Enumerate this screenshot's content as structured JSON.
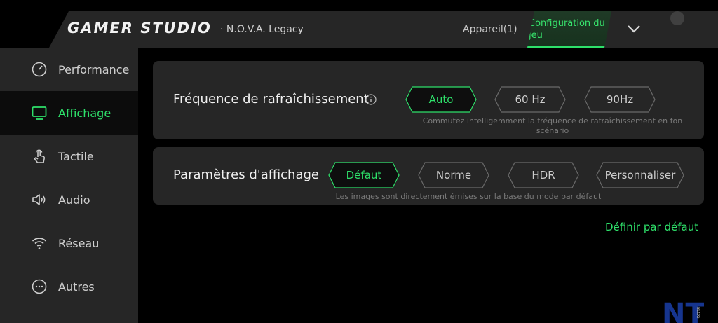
{
  "header": {
    "brand": "GAMER STUDIO",
    "game": "· N.O.V.A. Legacy",
    "device": "Appareil(1)",
    "config_tab": "Configuration du jeu",
    "expand_icon": "chevron-down-icon"
  },
  "sidebar": {
    "items": [
      {
        "label": "Performance",
        "icon": "gauge-icon"
      },
      {
        "label": "Affichage",
        "icon": "monitor-icon"
      },
      {
        "label": "Tactile",
        "icon": "touch-hand-icon"
      },
      {
        "label": "Audio",
        "icon": "speaker-icon"
      },
      {
        "label": "Réseau",
        "icon": "wifi-icon"
      },
      {
        "label": "Autres",
        "icon": "more-dots-icon"
      }
    ],
    "active_index": 1
  },
  "refresh": {
    "title": "Fréquence de rafraîchissement",
    "options": [
      "Auto",
      "60 Hz",
      "90Hz"
    ],
    "selected": "Auto",
    "description": "Commutez intelligemment la fréquence de rafraîchissement en fon scénario"
  },
  "display": {
    "title": "Paramètres d'affichage",
    "options": [
      "Défaut",
      "Norme",
      "HDR",
      "Personnaliser"
    ],
    "selected": "Défaut",
    "description": "Les images sont directement émises sur la base du mode par défaut"
  },
  "actions": {
    "set_default": "Définir par défaut"
  },
  "watermark": {
    "text": "NT",
    "sub": "BLOG"
  },
  "colors": {
    "accent": "#2ee06a",
    "panel": "#262626",
    "background": "#000000"
  }
}
